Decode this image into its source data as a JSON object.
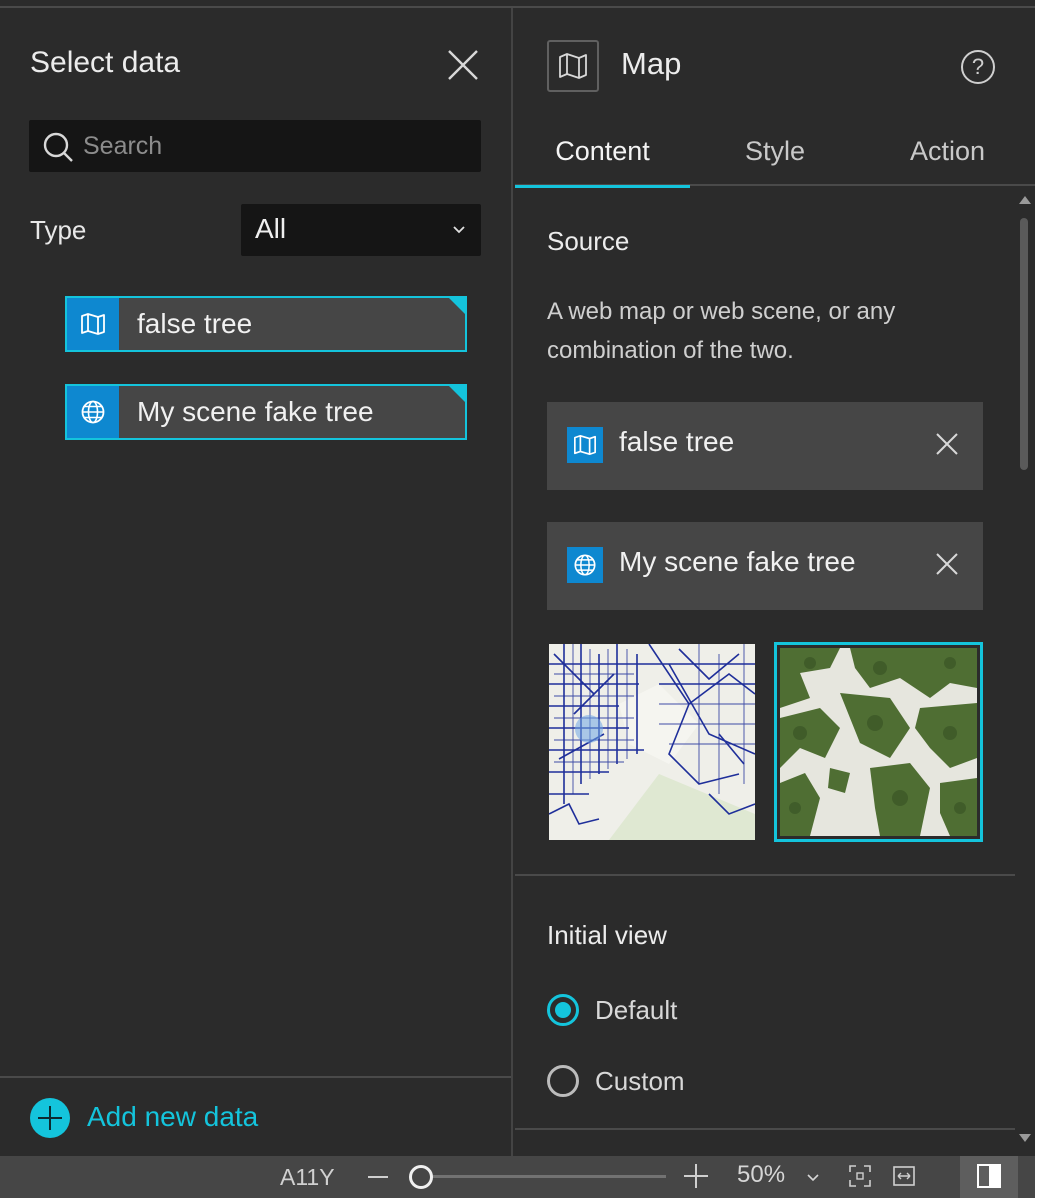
{
  "left_panel": {
    "title": "Select data",
    "search_placeholder": "Search",
    "type_label": "Type",
    "type_value": "All",
    "items": [
      {
        "label": "false tree",
        "icon": "map-icon"
      },
      {
        "label": "My scene fake tree",
        "icon": "globe-icon"
      }
    ],
    "add_data_label": "Add new data"
  },
  "right_panel": {
    "title": "Map",
    "help_glyph": "?",
    "tabs": [
      {
        "label": "Content",
        "active": true
      },
      {
        "label": "Style",
        "active": false
      },
      {
        "label": "Action",
        "active": false
      }
    ],
    "source": {
      "title": "Source",
      "description": "A web map or web scene, or any combination of the two.",
      "cards": [
        {
          "label": "false tree",
          "icon": "map-icon"
        },
        {
          "label": "My scene fake tree",
          "icon": "globe-icon"
        }
      ],
      "selected_thumbnail": 2
    },
    "initial_view": {
      "title": "Initial view",
      "options": [
        {
          "label": "Default",
          "checked": true
        },
        {
          "label": "Custom",
          "checked": false
        }
      ]
    }
  },
  "status_bar": {
    "a11y_label": "A11Y",
    "zoom_value": "50%",
    "zoom_slider_fraction": 0.0
  },
  "colors": {
    "accent": "#14c4dc",
    "icon_blue": "#0e88d0",
    "panel_bg": "#2b2b2b",
    "card_bg": "#464646"
  }
}
